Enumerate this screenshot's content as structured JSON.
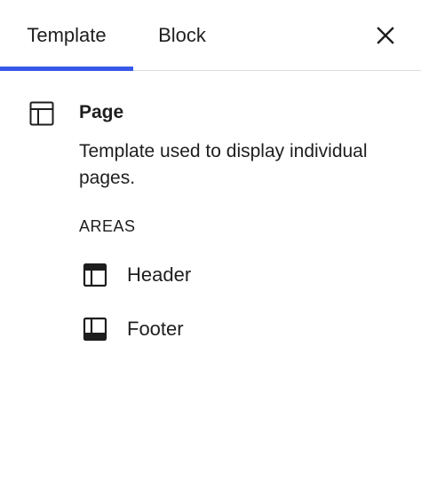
{
  "tabs": [
    {
      "label": "Template",
      "active": true
    },
    {
      "label": "Block",
      "active": false
    }
  ],
  "accent_color": "#3858e9",
  "close_icon": "close-icon",
  "template": {
    "icon": "layout-icon",
    "title": "Page",
    "description": "Template used to display individual pages."
  },
  "areas": {
    "heading": "AREAS",
    "items": [
      {
        "label": "Header",
        "icon": "header-area-icon"
      },
      {
        "label": "Footer",
        "icon": "footer-area-icon"
      }
    ]
  }
}
